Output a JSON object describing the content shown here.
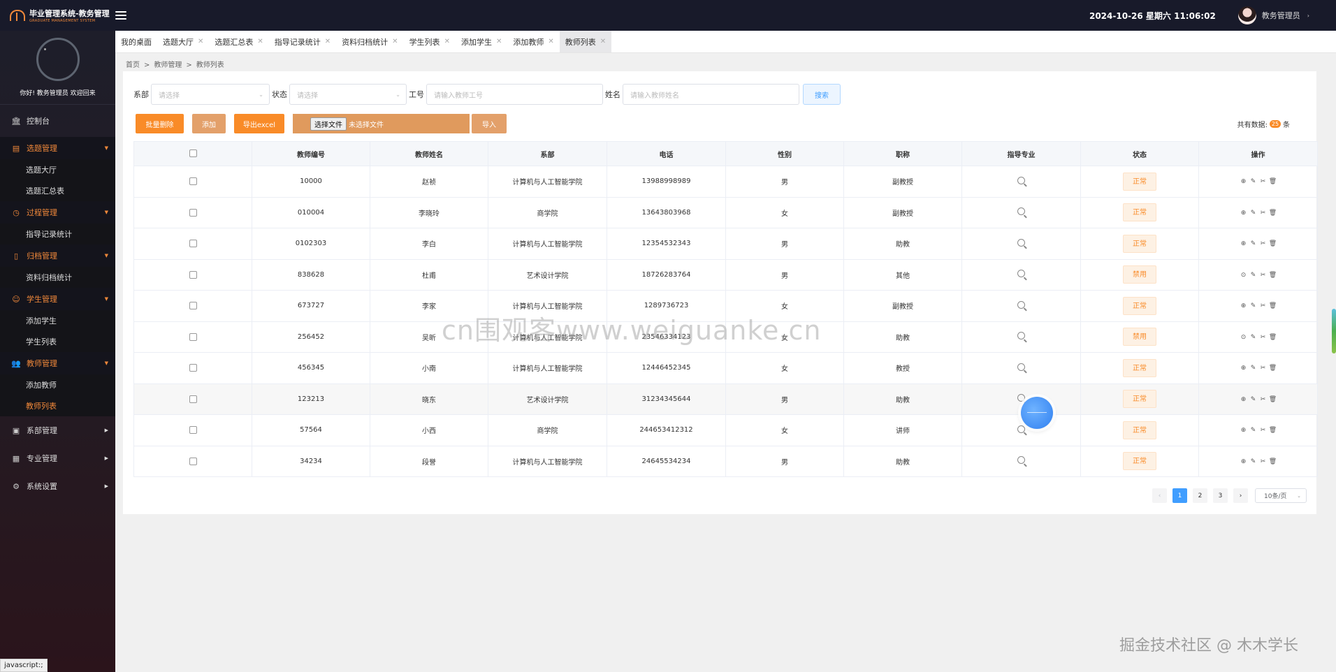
{
  "header": {
    "title": "毕业管理系统-教务管理",
    "subtitle": "GRADUATE MANAGEMENT SYSTEM",
    "datetime": "2024-10-26  星期六  11:06:02",
    "user": "教务管理员",
    "user_caret": "›"
  },
  "sidebar": {
    "greeting": "你好!  教务管理员 欢迎回来",
    "items": [
      {
        "label": "控制台",
        "icon": "🏛"
      },
      {
        "label": "选题管理",
        "icon": "▤",
        "subs": [
          "选题大厅",
          "选题汇总表"
        ]
      },
      {
        "label": "过程管理",
        "icon": "◷",
        "subs": [
          "指导记录统计"
        ]
      },
      {
        "label": "归档管理",
        "icon": "▯",
        "subs": [
          "资料归档统计"
        ]
      },
      {
        "label": "学生管理",
        "icon": "☺",
        "subs": [
          "添加学生",
          "学生列表"
        ]
      },
      {
        "label": "教师管理",
        "icon": "👥",
        "subs": [
          "添加教师",
          "教师列表"
        ]
      },
      {
        "label": "系部管理",
        "icon": "▣"
      },
      {
        "label": "专业管理",
        "icon": "▦"
      },
      {
        "label": "系统设置",
        "icon": "⚙"
      }
    ]
  },
  "tabs": [
    "我的桌面",
    "选题大厅",
    "选题汇总表",
    "指导记录统计",
    "资料归档统计",
    "学生列表",
    "添加学生",
    "添加教师",
    "教师列表"
  ],
  "breadcrumb": [
    "首页",
    "教师管理",
    "教师列表"
  ],
  "filters": {
    "dept_label": "系部",
    "dept_placeholder": "请选择",
    "status_label": "状态",
    "status_placeholder": "请选择",
    "id_label": "工号",
    "id_placeholder": "请输入教师工号",
    "name_label": "姓名",
    "name_placeholder": "请输入教师姓名",
    "search": "搜索"
  },
  "actions": {
    "batch_delete": "批量删除",
    "add": "添加",
    "export": "导出excel",
    "choose_file": "选择文件",
    "no_file": "未选择文件",
    "import": "导入",
    "total_prefix": "共有数据:",
    "total_count": "25",
    "total_suffix": "条"
  },
  "table": {
    "headers": [
      "教师编号",
      "教师姓名",
      "系部",
      "电话",
      "性别",
      "职称",
      "指导专业",
      "状态",
      "操作"
    ],
    "rows": [
      {
        "id": "10000",
        "name": "赵祯",
        "dept": "计算机与人工智能学院",
        "phone": "13988998989",
        "gender": "男",
        "title": "副教授",
        "status": "正常",
        "toggle_icon": "⊕"
      },
      {
        "id": "010004",
        "name": "李晓玲",
        "dept": "商学院",
        "phone": "13643803968",
        "gender": "女",
        "title": "副教授",
        "status": "正常",
        "toggle_icon": "⊕"
      },
      {
        "id": "0102303",
        "name": "李白",
        "dept": "计算机与人工智能学院",
        "phone": "12354532343",
        "gender": "男",
        "title": "助教",
        "status": "正常",
        "toggle_icon": "⊕"
      },
      {
        "id": "838628",
        "name": "杜甫",
        "dept": "艺术设计学院",
        "phone": "18726283764",
        "gender": "男",
        "title": "其他",
        "status": "禁用",
        "toggle_icon": "⊙"
      },
      {
        "id": "673727",
        "name": "李家",
        "dept": "计算机与人工智能学院",
        "phone": "1289736723",
        "gender": "女",
        "title": "副教授",
        "status": "正常",
        "toggle_icon": "⊕"
      },
      {
        "id": "256452",
        "name": "吴昕",
        "dept": "计算机与人工智能学院",
        "phone": "23546334123",
        "gender": "女",
        "title": "助教",
        "status": "禁用",
        "toggle_icon": "⊙"
      },
      {
        "id": "456345",
        "name": "小南",
        "dept": "计算机与人工智能学院",
        "phone": "12446452345",
        "gender": "女",
        "title": "教授",
        "status": "正常",
        "toggle_icon": "⊕"
      },
      {
        "id": "123213",
        "name": "晓东",
        "dept": "艺术设计学院",
        "phone": "31234345644",
        "gender": "男",
        "title": "助教",
        "status": "正常",
        "toggle_icon": "⊕"
      },
      {
        "id": "57564",
        "name": "小西",
        "dept": "商学院",
        "phone": "244653412312",
        "gender": "女",
        "title": "讲师",
        "status": "正常",
        "toggle_icon": "⊕"
      },
      {
        "id": "34234",
        "name": "段誉",
        "dept": "计算机与人工智能学院",
        "phone": "24645534234",
        "gender": "男",
        "title": "助教",
        "status": "正常",
        "toggle_icon": "⊕"
      }
    ]
  },
  "pagination": {
    "prev": "‹",
    "pages": [
      "1",
      "2",
      "3"
    ],
    "next": "›",
    "page_size": "10条/页"
  },
  "watermark": "掘金技术社区 @ 木木学长",
  "watermark_center": "cn围观客www.weiguanke.cn",
  "statusbar": "javascript:;",
  "colors": {
    "accent": "#f98b28",
    "primary": "#409eff",
    "topbar": "#181a2a"
  }
}
